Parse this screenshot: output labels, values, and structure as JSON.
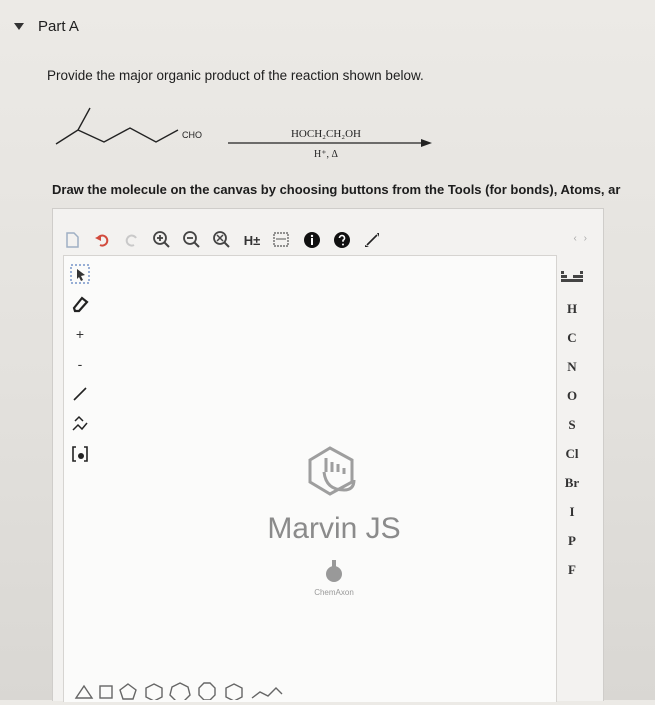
{
  "part": {
    "title": "Part A"
  },
  "question": {
    "text": "Provide the major organic product of the reaction shown below."
  },
  "reaction": {
    "substituent": "CHO",
    "reagent": "HOCH₂CH₂OH",
    "conditions": "H⁺, Δ"
  },
  "instructions": {
    "text": "Draw the molecule on the canvas by choosing buttons from the Tools (for bonds), Atoms, ar"
  },
  "editor": {
    "toolbar": {
      "h_label": "H±",
      "scroll": "‹ ›"
    },
    "left_tools": [
      "+",
      "-"
    ],
    "atoms": [
      "H",
      "C",
      "N",
      "O",
      "S",
      "Cl",
      "Br",
      "I",
      "P",
      "F"
    ],
    "brand": "Marvin JS",
    "vendor": "ChemAxon"
  }
}
